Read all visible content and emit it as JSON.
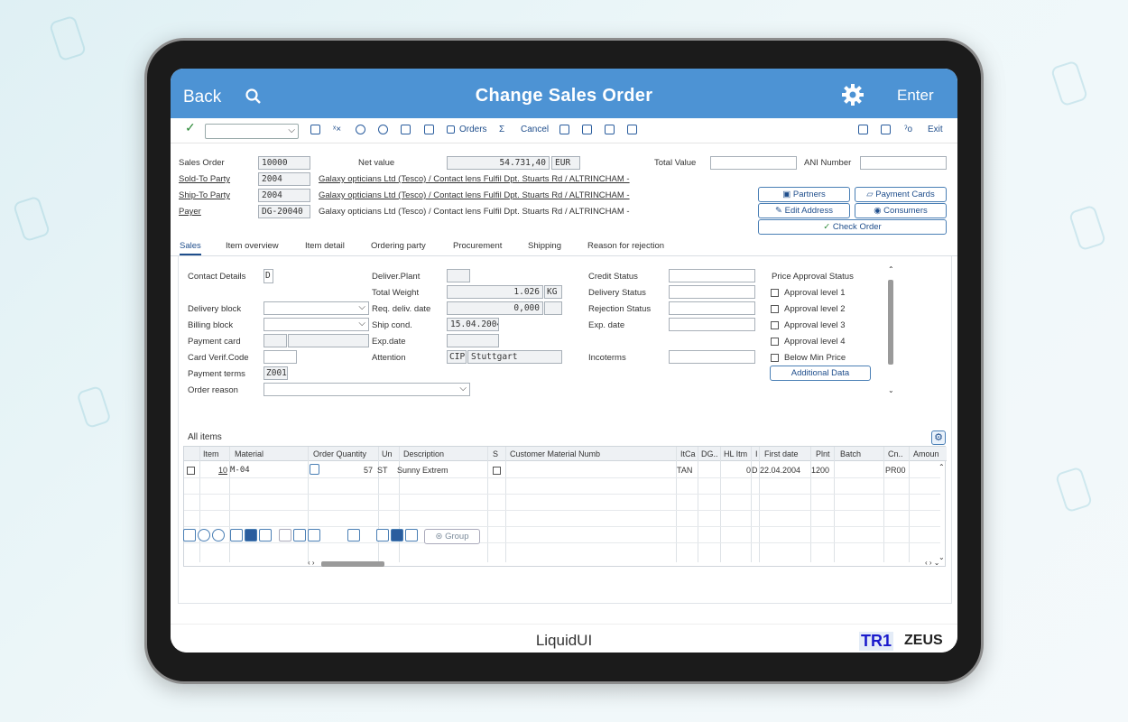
{
  "header": {
    "back_label": "Back",
    "title": "Change Sales Order",
    "enter_label": "Enter"
  },
  "toolbar": {
    "orders_label": "Orders",
    "sigma_label": "Σ",
    "cancel_label": "Cancel",
    "exit_label": "Exit"
  },
  "order": {
    "sales_order_label": "Sales Order",
    "sales_order_value": "10000",
    "net_value_label": "Net value",
    "net_value": "54.731,40",
    "currency": "EUR",
    "total_value_label": "Total Value",
    "ani_label": "ANI Number",
    "sold_to_label": "Sold-To Party",
    "sold_to_value": "2004",
    "ship_to_label": "Ship-To Party",
    "ship_to_value": "2004",
    "payer_label": "Payer",
    "payer_value": "DG-20040",
    "party_desc": "Galaxy opticians Ltd (Tesco) / Contact lens Fulfil Dpt. Stuarts Rd / ALTRINCHAM -"
  },
  "actions": {
    "partners": "Partners",
    "payment_cards": "Payment Cards",
    "edit_address": "Edit Address",
    "consumers": "Consumers",
    "check_order": "Check Order"
  },
  "tabs": [
    "Sales",
    "Item overview",
    "Item detail",
    "Ordering party",
    "Procurement",
    "Shipping",
    "Reason for rejection"
  ],
  "sales": {
    "contact_details_label": "Contact Details",
    "contact_details_value": "D",
    "delivery_block_label": "Delivery block",
    "billing_block_label": "Billing block",
    "payment_card_label": "Payment card",
    "card_verif_label": "Card Verif.Code",
    "payment_terms_label": "Payment terms",
    "payment_terms_value": "Z001",
    "order_reason_label": "Order reason",
    "deliver_plant_label": "Deliver.Plant",
    "total_weight_label": "Total Weight",
    "total_weight_value": "1.026",
    "weight_unit": "KG",
    "req_deliv_label": "Req. deliv. date",
    "req_deliv_value": "0,000",
    "ship_cond_label": "Ship cond.",
    "ship_cond_value": "15.04.2004",
    "exp_date_label": "Exp.date",
    "attention_label": "Attention",
    "attention_code": "CIP",
    "attention_value": "Stuttgart",
    "credit_status_label": "Credit Status",
    "delivery_status_label": "Delivery Status",
    "rejection_status_label": "Rejection Status",
    "exp_date2_label": "Exp. date",
    "incoterms_label": "Incoterms",
    "price_approval_label": "Price Approval Status",
    "approvals": [
      "Approval level 1",
      "Approval level 2",
      "Approval level 3",
      "Approval level 4",
      "Below Min Price"
    ],
    "additional_data": "Additional Data"
  },
  "items": {
    "title": "All items",
    "columns": [
      "Item",
      "Material",
      "Order Quantity",
      "Un",
      "Description",
      "S",
      "Customer Material Numb",
      "ItCa",
      "DG..",
      "HL Itm",
      "I",
      "First date",
      "Plnt",
      "Batch",
      "Cn..",
      "Amoun"
    ],
    "rows": [
      {
        "item": "10",
        "material": "M-04",
        "qty": "57",
        "un": "ST",
        "desc": "Sunny Extrem",
        "itca": "TAN",
        "hl": "0",
        "d": "D",
        "first_date": "22.04.2004",
        "plnt": "1200",
        "cn": "PR00"
      }
    ],
    "group_label": "Group"
  },
  "footer": {
    "brand": "LiquidUI",
    "sys1": "TR1",
    "sys2": "ZEUS"
  }
}
